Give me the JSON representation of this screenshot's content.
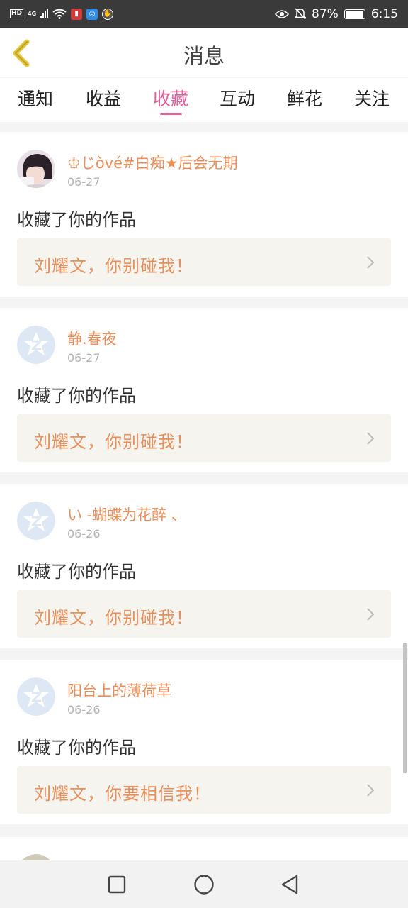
{
  "status_bar": {
    "left_icons": [
      "hd-icon",
      "network-4g-icon",
      "signal-icon",
      "wifi-icon",
      "app-notification-icon",
      "browser-app-icon",
      "gallery-app-icon"
    ],
    "network_label": "4G",
    "hd_label": "HD",
    "right_icons": [
      "eye-icon",
      "bell-off-icon",
      "battery-icon"
    ],
    "battery": "87%",
    "time": "6:15"
  },
  "header": {
    "title": "消息",
    "back_icon": "chevron-left-icon"
  },
  "tabs": [
    {
      "label": "通知",
      "active": false
    },
    {
      "label": "收益",
      "active": false
    },
    {
      "label": "收藏",
      "active": true
    },
    {
      "label": "互动",
      "active": false
    },
    {
      "label": "鲜花",
      "active": false
    },
    {
      "label": "关注",
      "active": false
    }
  ],
  "messages": [
    {
      "username": "♔じòvé#白痴★后会无期",
      "date": "06-27",
      "action": "收藏了你的作品",
      "work_title": "刘耀文，你别碰我！",
      "avatar": "user-photo"
    },
    {
      "username": "静.春夜",
      "date": "06-27",
      "action": "收藏了你的作品",
      "work_title": "刘耀文，你别碰我！",
      "avatar": "default-avatar"
    },
    {
      "username": "い -蝴蝶为花醉 、",
      "date": "06-26",
      "action": "收藏了你的作品",
      "work_title": "刘耀文，你别碰我！",
      "avatar": "default-avatar"
    },
    {
      "username": "阳台上的薄荷草",
      "date": "06-26",
      "action": "收藏了你的作品",
      "work_title": "刘耀文，你要相信我！",
      "avatar": "default-avatar"
    }
  ],
  "nav_bar": {
    "buttons": [
      "recent-apps-icon",
      "home-icon",
      "back-triangle-icon"
    ]
  },
  "colors": {
    "accent": "#e0609a",
    "username": "#e8905c",
    "work_bg": "#f5f4ee",
    "status_bar": "#3a3a3a"
  }
}
